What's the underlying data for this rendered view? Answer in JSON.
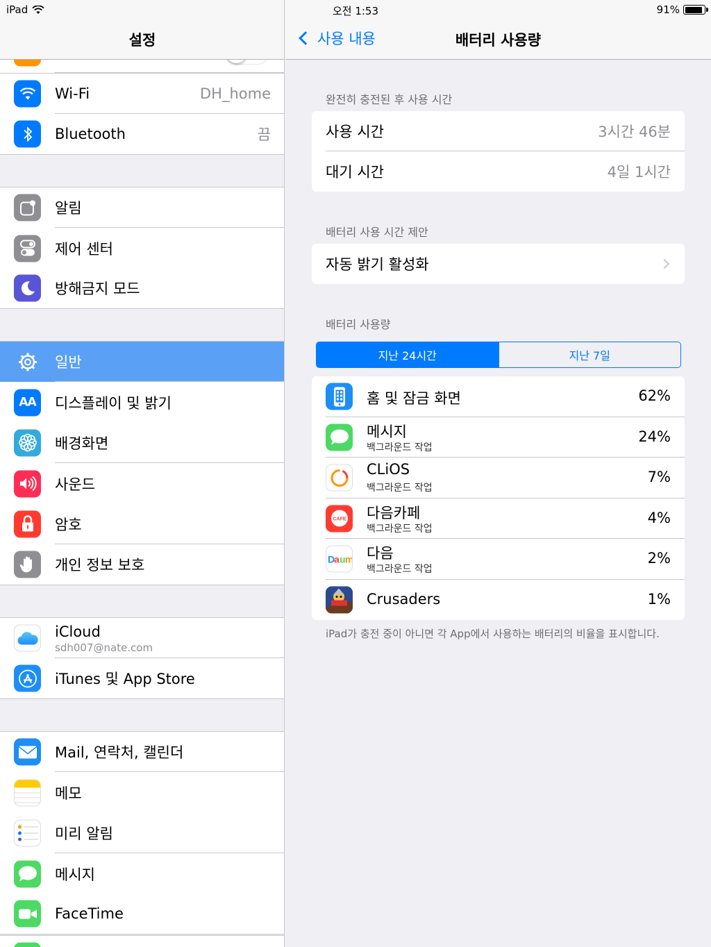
{
  "status": {
    "device": "iPad",
    "time": "오전 1:53",
    "battery_pct": "91%",
    "battery_level": 0.91
  },
  "left": {
    "title": "설정",
    "group1": [
      {
        "label": "Wi-Fi",
        "value": "DH_home",
        "icon": "wifi-icon",
        "color": "#007aff"
      },
      {
        "label": "Bluetooth",
        "value": "끔",
        "icon": "bluetooth-icon",
        "color": "#007aff"
      }
    ],
    "group2": [
      {
        "label": "알림",
        "icon": "notifications-icon",
        "color": "#8e8e93"
      },
      {
        "label": "제어 센터",
        "icon": "control-center-icon",
        "color": "#8e8e93"
      },
      {
        "label": "방해금지 모드",
        "icon": "moon-icon",
        "color": "#5856d6"
      }
    ],
    "group3": [
      {
        "label": "일반",
        "icon": "gear-icon",
        "color": "#8e8e93",
        "selected": true
      },
      {
        "label": "디스플레이 및 밝기",
        "icon": "display-icon",
        "color": "#007aff"
      },
      {
        "label": "배경화면",
        "icon": "wallpaper-icon",
        "color": "#34aadc"
      },
      {
        "label": "사운드",
        "icon": "speaker-icon",
        "color": "#ff2d55"
      },
      {
        "label": "암호",
        "icon": "lock-icon",
        "color": "#ff3b30"
      },
      {
        "label": "개인 정보 보호",
        "icon": "hand-icon",
        "color": "#8e8e93"
      }
    ],
    "group4": [
      {
        "label": "iCloud",
        "sub": "sdh007@nate.com",
        "icon": "icloud-icon",
        "color": "#ffffff"
      },
      {
        "label": "iTunes 및 App Store",
        "icon": "app-store-icon",
        "color": "#1d8ef5"
      }
    ],
    "group5": [
      {
        "label": "Mail, 연락처, 캘린더",
        "icon": "mail-icon",
        "color": "#1d8ef5"
      },
      {
        "label": "메모",
        "icon": "notes-icon",
        "color": "#ffcc00"
      },
      {
        "label": "미리 알림",
        "icon": "reminders-icon",
        "color": "#ffffff"
      },
      {
        "label": "메시지",
        "icon": "messages-icon",
        "color": "#4cd964"
      },
      {
        "label": "FaceTime",
        "icon": "facetime-icon",
        "color": "#4cd964"
      }
    ]
  },
  "right": {
    "back_label": "사용 내용",
    "title": "배터리 사용량",
    "section1_header": "완전히 충전된 후 사용 시간",
    "usage_label": "사용 시간",
    "usage_value": "3시간 46분",
    "standby_label": "대기 시간",
    "standby_value": "4일 1시간",
    "section2_header": "배터리 사용 시간 제안",
    "auto_brightness_label": "자동 밝기 활성화",
    "section3_header": "배터리 사용량",
    "segment_24h": "지난 24시간",
    "segment_7d": "지난 7일",
    "apps": [
      {
        "name": "홈 및 잠금 화면",
        "sub": "",
        "pct": "62%",
        "icon": "home-lock-screen-icon",
        "color": "#1d8ef5"
      },
      {
        "name": "메시지",
        "sub": "백그라운드 작업",
        "pct": "24%",
        "icon": "messages-icon",
        "color": "#4cd964"
      },
      {
        "name": "CLiOS",
        "sub": "백그라운드 작업",
        "pct": "7%",
        "icon": "clios-icon",
        "color": "#ffffff"
      },
      {
        "name": "다음카페",
        "sub": "백그라운드 작업",
        "pct": "4%",
        "icon": "daum-cafe-icon",
        "color": "#ff3b30"
      },
      {
        "name": "다음",
        "sub": "백그라운드 작업",
        "pct": "2%",
        "icon": "daum-icon",
        "color": "#ffffff"
      },
      {
        "name": "Crusaders",
        "sub": "",
        "pct": "1%",
        "icon": "crusaders-icon",
        "color": "#3a5fb0"
      }
    ],
    "footnote": "iPad가 충전 중이 아니면 각 App에서 사용하는 배터리의 비율을 표시합니다."
  }
}
